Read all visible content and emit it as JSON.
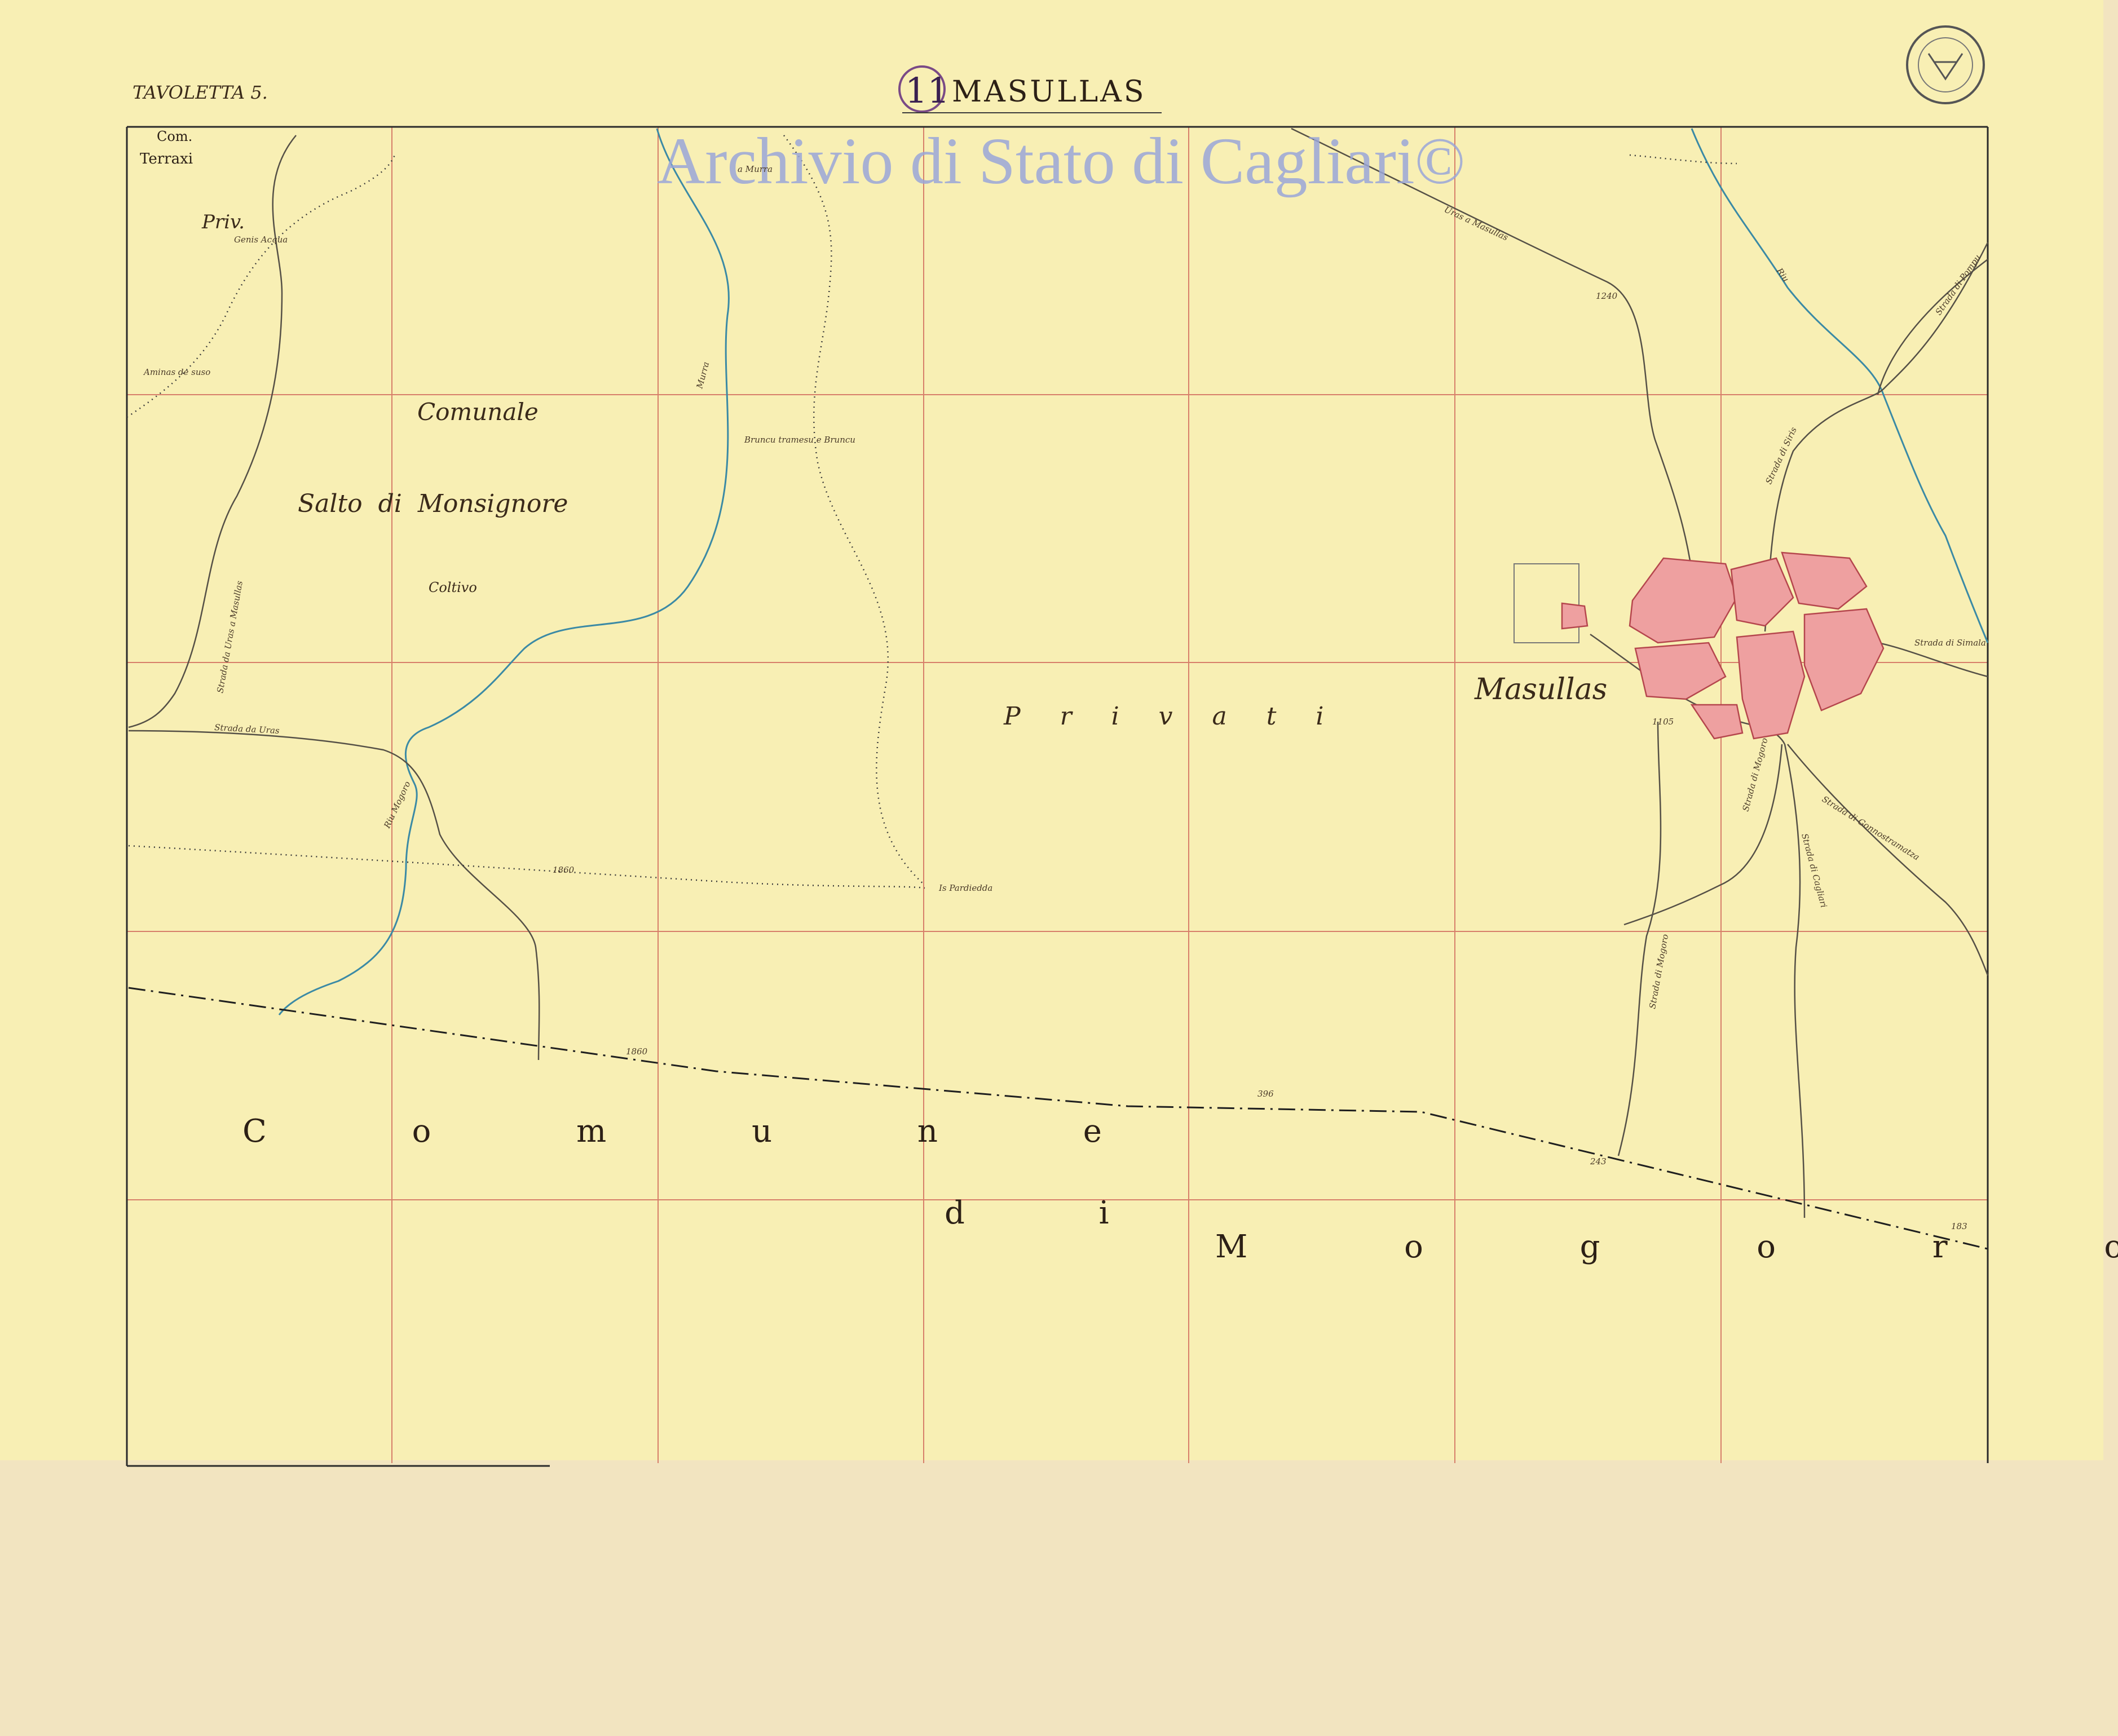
{
  "sheet": {
    "tavoletta": "TAVOLETTA 5.",
    "title": "MASULLAS",
    "stamp_number": "11",
    "watermark": "Archivio di Stato di Cagliari©"
  },
  "labels": {
    "com": "Com.",
    "terraxi": "Terraxi",
    "priv": "Priv.",
    "genis_acqua": "Genis Acqua",
    "aminas": "Aminas de suso",
    "strada_uras_masullas": "Strada da Uras a Masullas",
    "comunale": "Comunale",
    "salto": "Salto di Monsignore",
    "coltivo": "Coltivo",
    "strada_uras": "Strada da Uras",
    "riu_mogoro": "Riu Mogoro",
    "a_murra": "a Murra",
    "murra": "Murra",
    "bruncu": "Bruncu tramesu e Bruncu",
    "is_pardiedda": "Is Pardiedda",
    "privati": "P r i v a t i",
    "masullas_town": "Masullas",
    "uras_masullas_ne": "Uras a Masullas",
    "riu": "Riu",
    "strada_di_pompu": "Strada di Pompu",
    "strada_di_siris": "Strada di Siris",
    "strada_di_simala": "Strada di Simala",
    "strada_di_mogoro": "Strada di Mogoro",
    "strada_di_cagliari": "Strada di Cagliari",
    "strada_di_gonnostramatza": "Strada di Gonnostramatza",
    "comune_word": "C o m u n e",
    "di_word": "d i",
    "mogoro_word": "M o g o r o"
  },
  "elevations": {
    "e1": "1860",
    "e2": "1860",
    "e3": "396",
    "e4": "243",
    "e5": "183",
    "e6": "1105",
    "e7": "1240"
  },
  "colors": {
    "paper": "#f8efb4",
    "margin": "#f2e4c0",
    "grid": "#d77f6a",
    "border": "#2a2a2a",
    "river": "#3b8aa5",
    "road": "#555046",
    "town": "#eea0a0",
    "town_edge": "#b5464d",
    "watermark": "#9aa6d8",
    "stamp": "#7a4a86"
  }
}
